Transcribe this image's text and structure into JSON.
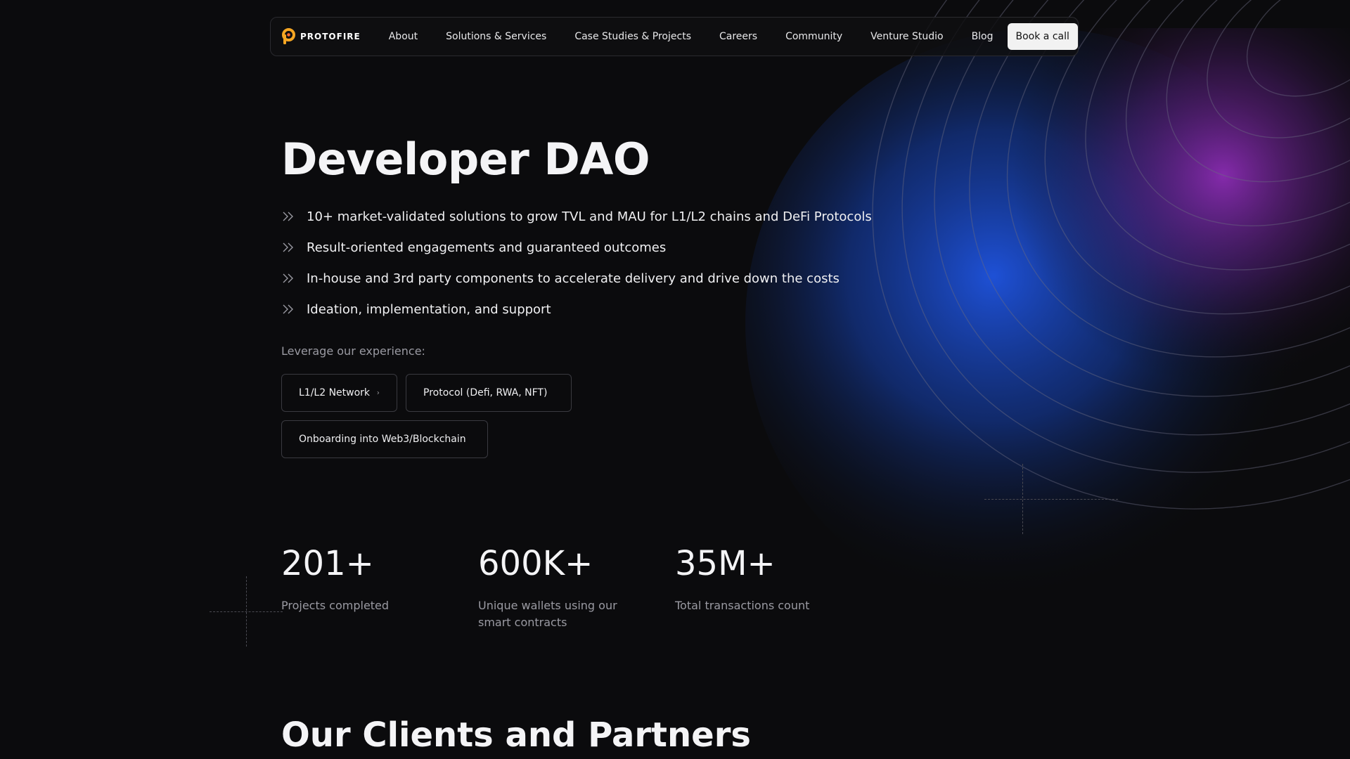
{
  "nav": {
    "logo_text": "PROTOFIRE",
    "links": [
      "About",
      "Solutions & Services",
      "Case Studies & Projects",
      "Careers",
      "Community",
      "Venture Studio",
      "Blog"
    ],
    "cta": "Book a call"
  },
  "hero": {
    "title": "Developer DAO",
    "bullets": [
      "10+ market-validated solutions to grow TVL and MAU for L1/L2 chains and DeFi Protocols",
      "Result-oriented engagements and guaranteed outcomes",
      "In-house and 3rd party components to accelerate delivery and drive down the costs",
      "Ideation, implementation, and support"
    ],
    "leverage_label": "Leverage our experience:",
    "chips": [
      "L1/L2 Network",
      "Protocol (Defi, RWA, NFT)",
      "Onboarding into Web3/Blockchain"
    ]
  },
  "stats": [
    {
      "value": "201+",
      "label": "Projects completed"
    },
    {
      "value": "600K+",
      "label": "Unique wallets using our smart contracts"
    },
    {
      "value": "35M+",
      "label": "Total transactions count"
    }
  ],
  "clients": {
    "title": "Our Clients and Partners"
  },
  "colors": {
    "background": "#0b0b0d",
    "logo_orange": "#f5a623",
    "glow_blue": "#1d4fd6",
    "glow_purple": "#8a2bb5",
    "cta_bg": "#f2f2f2"
  },
  "icons": {
    "logo": "protofire-logo-icon",
    "bullet": "double-chevron-right-icon",
    "chip": "chevron-right-icon"
  }
}
